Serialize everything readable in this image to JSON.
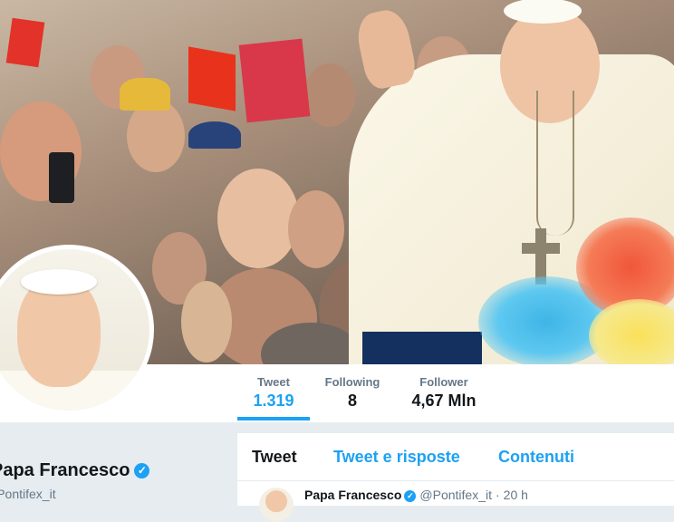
{
  "header": {
    "photo_alt": "Pope waving to crowd"
  },
  "profile": {
    "name": "Papa Francesco",
    "handle": "@Pontifex_it",
    "verified": true
  },
  "stats": [
    {
      "label": "Tweet",
      "value": "1.319",
      "active": true
    },
    {
      "label": "Following",
      "value": "8",
      "active": false
    },
    {
      "label": "Follower",
      "value": "4,67 Mln",
      "active": false
    }
  ],
  "tabs": [
    {
      "label": "Tweet",
      "active": true
    },
    {
      "label": "Tweet e risposte",
      "active": false
    },
    {
      "label": "Contenuti",
      "active": false
    }
  ],
  "tweet": {
    "author_name": "Papa Francesco",
    "author_handle": "@Pontifex_it",
    "separator": "·",
    "time": "20 h"
  },
  "colors": {
    "accent": "#1da1f2",
    "text_primary": "#14171a",
    "text_secondary": "#657786",
    "background": "#e6ecf0"
  },
  "icons": {
    "verified": "verified-badge-icon"
  }
}
